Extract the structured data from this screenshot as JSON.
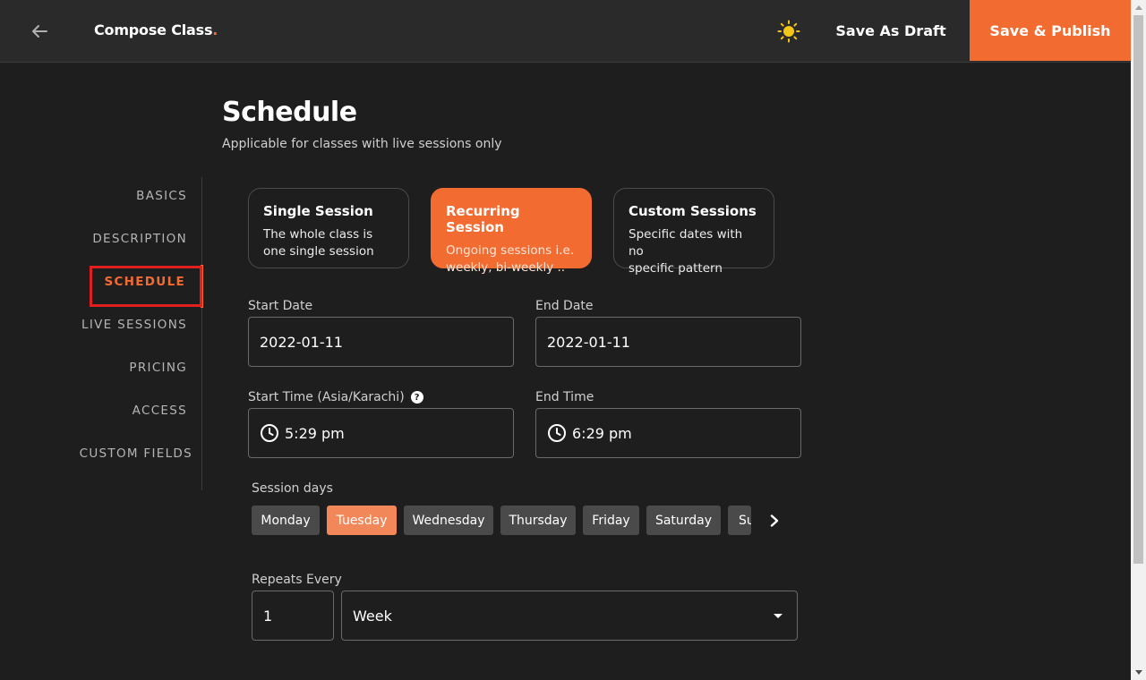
{
  "header": {
    "title": "Compose Class",
    "title_dot": ".",
    "save_draft_label": "Save As Draft",
    "publish_label": "Save & Publish"
  },
  "page": {
    "heading": "Schedule",
    "subheading": "Applicable for classes with live sessions only"
  },
  "nav": {
    "active": "SCHEDULE",
    "items": [
      "BASICS",
      "DESCRIPTION",
      "SCHEDULE",
      "LIVE SESSIONS",
      "PRICING",
      "ACCESS",
      "CUSTOM FIELDS"
    ]
  },
  "session_types": [
    {
      "title": "Single Session",
      "desc_line1": "The whole class is",
      "desc_line2": "one single session",
      "selected": false
    },
    {
      "title": "Recurring Session",
      "desc_line1": "Ongoing sessions i.e.",
      "desc_line2": "weekly, bi-weekly ..",
      "selected": true
    },
    {
      "title": "Custom Sessions",
      "desc_line1": "Specific dates with no",
      "desc_line2": "specific pattern",
      "selected": false
    }
  ],
  "fields": {
    "start_date_label": "Start Date",
    "start_date_value": "2022-01-11",
    "end_date_label": "End Date",
    "end_date_value": "2022-01-11",
    "start_time_label": "Start Time (Asia/Karachi)",
    "start_time_value": "5:29 pm",
    "end_time_label": "End Time",
    "end_time_value": "6:29 pm",
    "help_glyph": "?"
  },
  "session_days": {
    "label": "Session days",
    "days": [
      "Monday",
      "Tuesday",
      "Wednesday",
      "Thursday",
      "Friday",
      "Saturday",
      "Su"
    ],
    "selected": [
      "Tuesday"
    ]
  },
  "repeats": {
    "label": "Repeats Every",
    "count": "1",
    "unit": "Week"
  },
  "colors": {
    "accent": "#f26c32",
    "chip_selected": "#f2875a",
    "background": "#1e1e1e",
    "topbar": "#2a2a2a",
    "highlight_box": "#e02020"
  },
  "icons": [
    "back-arrow-icon",
    "sun-icon",
    "help-icon",
    "clock-icon",
    "chevron-right-icon",
    "caret-down-icon"
  ]
}
